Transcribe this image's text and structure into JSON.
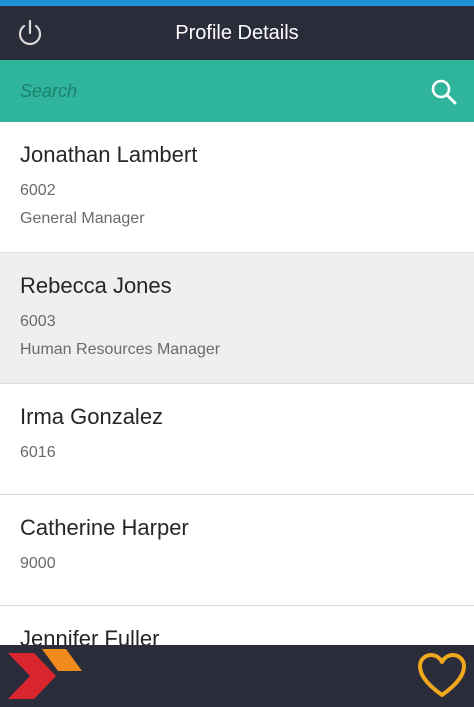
{
  "header": {
    "title": "Profile Details",
    "power_icon": "power-icon"
  },
  "search": {
    "placeholder": "Search",
    "value": "",
    "icon": "search-icon"
  },
  "profiles": [
    {
      "name": "Jonathan Lambert",
      "id": "6002",
      "title": "General Manager",
      "selected": false
    },
    {
      "name": "Rebecca Jones",
      "id": "6003",
      "title": "Human Resources Manager",
      "selected": true
    },
    {
      "name": "Irma Gonzalez",
      "id": "6016",
      "title": "",
      "selected": false
    },
    {
      "name": "Catherine Harper",
      "id": "9000",
      "title": "",
      "selected": false
    },
    {
      "name": "Jennifer Fuller",
      "id": "",
      "title": "",
      "selected": false
    }
  ],
  "footer": {
    "logo_icon": "brand-chevron-logo-icon",
    "favorite_icon": "heart-icon"
  },
  "colors": {
    "header_bg": "#2b2c3a",
    "top_accent": "#1f8fd6",
    "search_bg": "#2fb59c",
    "selected_row_bg": "#efefef",
    "logo_red": "#d9262e",
    "logo_orange": "#f08a1c",
    "heart_gold": "#f0a81c"
  }
}
